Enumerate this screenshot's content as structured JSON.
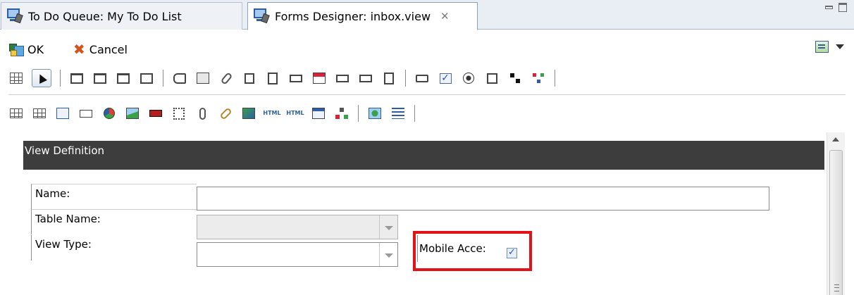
{
  "tabs": [
    {
      "label": "To Do Queue: My To Do List",
      "icon": "app-window-icon"
    },
    {
      "label": "Forms Designer: inbox.view",
      "icon": "app-window-icon",
      "close_glyph": "✕"
    }
  ],
  "toolbar": {
    "ok_label": "OK",
    "cancel_label": "Cancel",
    "cancel_glyph": "✖",
    "check_glyph": "✓",
    "text_glyph": "HTML"
  },
  "palette_icons": {
    "row1": [
      "grid-icon",
      "pointer-icon",
      "panel-icon",
      "tab-panel-icon",
      "frame-icon",
      "box-icon",
      "label-icon",
      "text-icon",
      "script-icon",
      "text-input-icon",
      "list-box-icon",
      "dropdown-icon",
      "calendar-icon",
      "combo-box-icon",
      "spinner-icon",
      "scroll-icon",
      "button-icon",
      "checkbox-icon",
      "radio-button-icon",
      "form-field-icon",
      "tree-icon",
      "org-chart-icon"
    ],
    "row2": [
      "table-icon",
      "column-icon",
      "timer-icon",
      "money-icon",
      "color-icon",
      "image-icon",
      "signature-icon",
      "dotted-frame-icon",
      "attachment-icon",
      "link-icon",
      "report-icon",
      "html-editor-icon",
      "html-view-icon",
      "data-view-icon",
      "hierarchy-icon",
      "web-icon",
      "lines-icon"
    ]
  },
  "form": {
    "section_title": "View Definition",
    "fields": {
      "name_label": "Name:",
      "name_value": "",
      "table_name_label": "Table Name:",
      "table_name_value": "",
      "view_type_label": "View Type:",
      "view_type_value": "",
      "mobile_access_label": "Mobile Acce:",
      "mobile_access_checked": true
    }
  },
  "colors": {
    "header_bg": "#3d3d3d",
    "highlight_border": "#e11218",
    "tab_bar_bg": "#e9edf4"
  }
}
